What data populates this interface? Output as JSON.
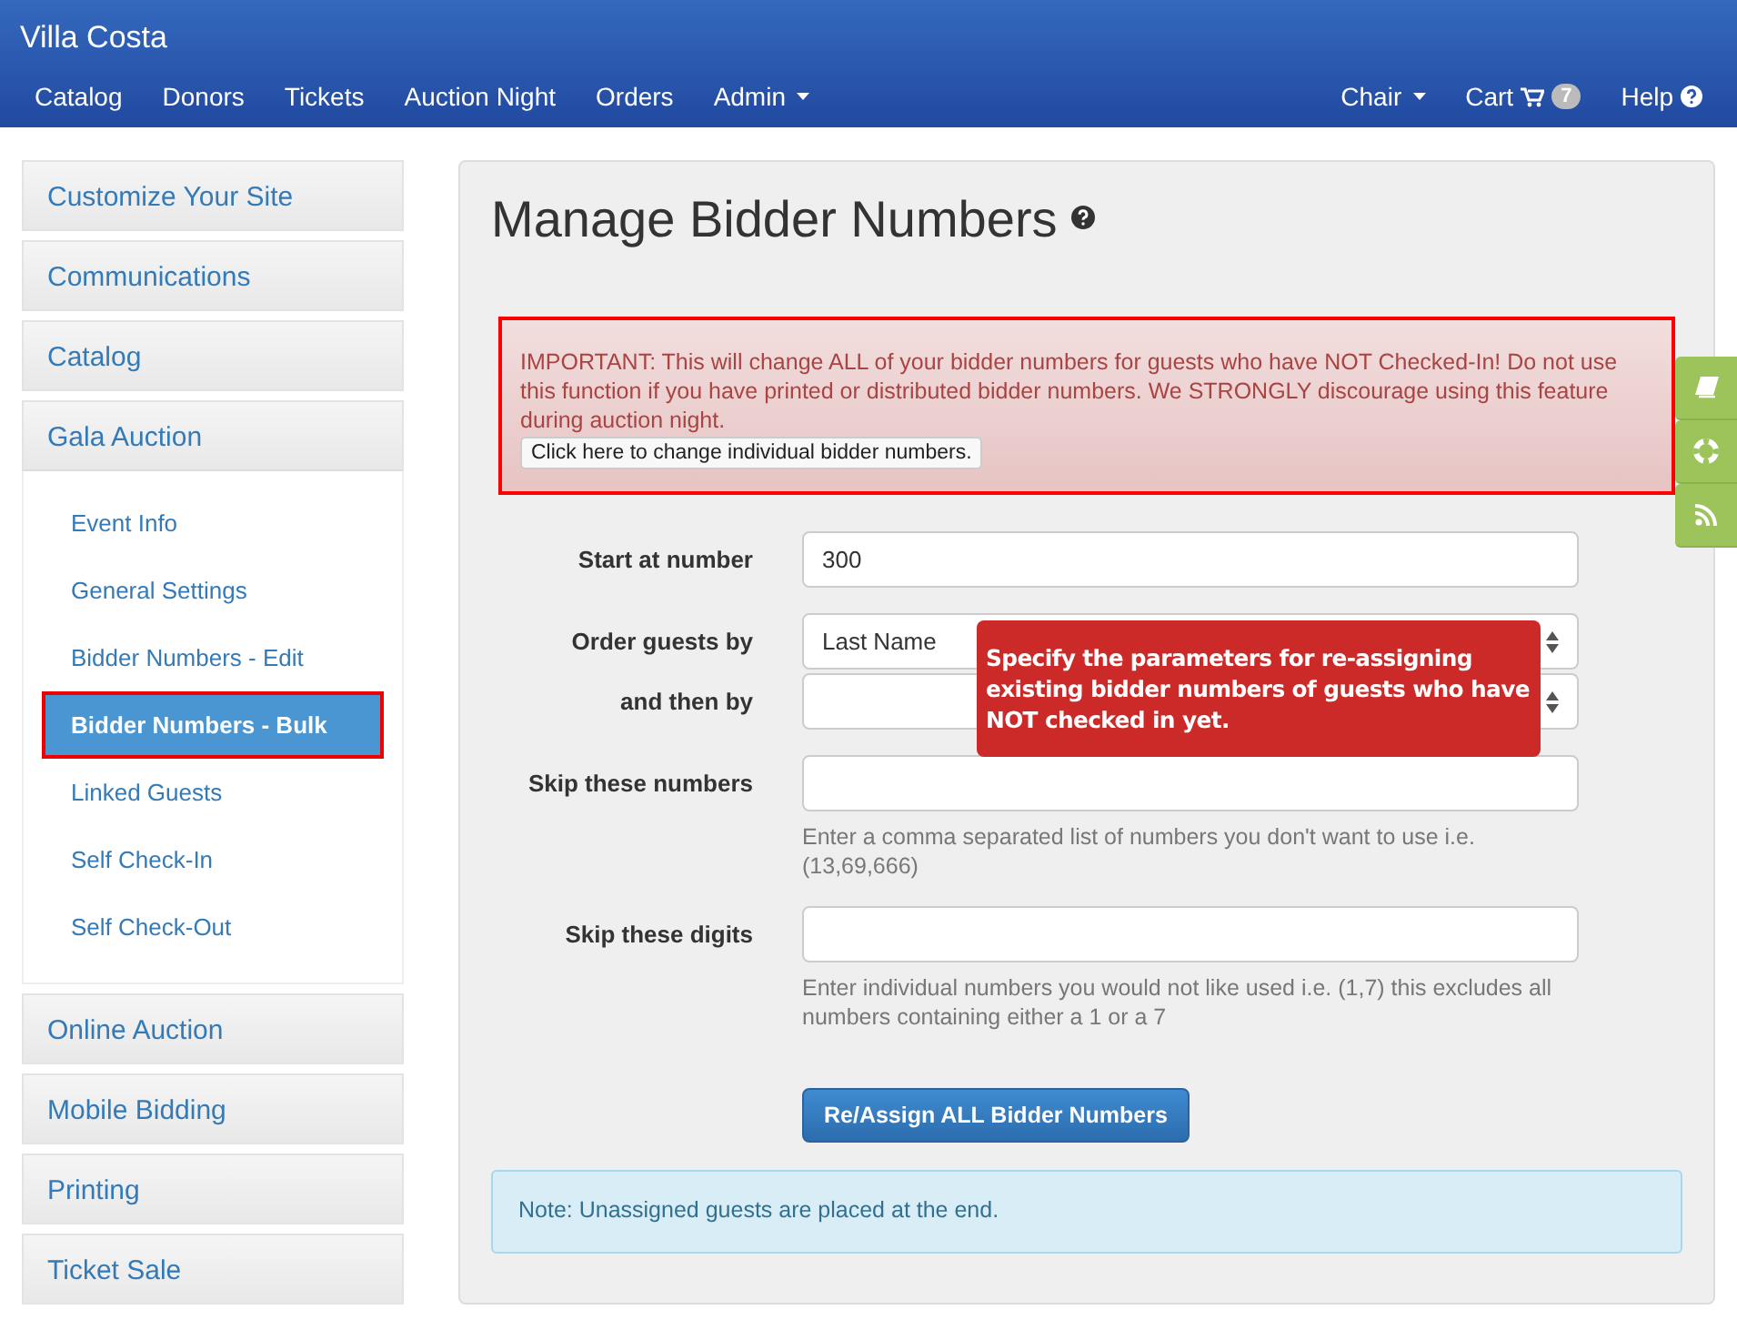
{
  "navbar": {
    "brand": "Villa Costa",
    "left_items": [
      {
        "label": "Catalog",
        "dropdown": false
      },
      {
        "label": "Donors",
        "dropdown": false
      },
      {
        "label": "Tickets",
        "dropdown": false
      },
      {
        "label": "Auction Night",
        "dropdown": false
      },
      {
        "label": "Orders",
        "dropdown": false
      },
      {
        "label": "Admin",
        "dropdown": true
      }
    ],
    "right_items": [
      {
        "label": "Chair",
        "kind": "dropdown"
      },
      {
        "label": "Cart",
        "kind": "cart",
        "badge": "7"
      },
      {
        "label": "Help",
        "kind": "help"
      }
    ]
  },
  "sidebar": {
    "items": [
      {
        "label": "Customize Your Site",
        "expanded": false
      },
      {
        "label": "Communications",
        "expanded": false
      },
      {
        "label": "Catalog",
        "expanded": false
      },
      {
        "label": "Gala Auction",
        "expanded": true,
        "children": [
          {
            "label": "Event Info",
            "selected": false,
            "highlighted": false
          },
          {
            "label": "General Settings",
            "selected": false,
            "highlighted": false
          },
          {
            "label": "Bidder Numbers - Edit",
            "selected": false,
            "highlighted": false
          },
          {
            "label": "Bidder Numbers - Bulk",
            "selected": true,
            "highlighted": true
          },
          {
            "label": "Linked Guests",
            "selected": false,
            "highlighted": false
          },
          {
            "label": "Self Check-In",
            "selected": false,
            "highlighted": false
          },
          {
            "label": "Self Check-Out",
            "selected": false,
            "highlighted": false
          }
        ]
      },
      {
        "label": "Online Auction",
        "expanded": false
      },
      {
        "label": "Mobile Bidding",
        "expanded": false
      },
      {
        "label": "Printing",
        "expanded": false
      },
      {
        "label": "Ticket Sale",
        "expanded": false
      }
    ]
  },
  "main": {
    "title": "Manage Bidder Numbers",
    "alert": {
      "text": "IMPORTANT: This will change ALL of your bidder numbers for guests who have NOT Checked-In! Do not use this function if you have printed or distributed bidder numbers. We STRONGLY discourage using this feature during auction night.",
      "button": "Click here to change individual bidder numbers.",
      "highlighted": true
    },
    "fields": [
      {
        "kind": "input",
        "label": "Start at number",
        "value": "300"
      },
      {
        "kind": "select",
        "label": "Order guests by",
        "value": "Last Name"
      },
      {
        "kind": "select",
        "label": "and then by"
      },
      {
        "kind": "input",
        "label": "Skip these numbers",
        "help": "Enter a comma separated list of numbers you don't want to use i.e. (13,69,666)"
      },
      {
        "kind": "input",
        "label": "Skip these digits",
        "help": "Enter individual numbers you would not like used i.e. (1,7) this excludes all numbers containing either a 1 or a 7"
      }
    ],
    "submit": "Re/Assign ALL Bidder Numbers",
    "note": "Note: Unassigned guests are placed at the end.",
    "callout": "Specify the parameters for re-assigning existing bidder numbers of guests who have NOT checked in yet."
  }
}
